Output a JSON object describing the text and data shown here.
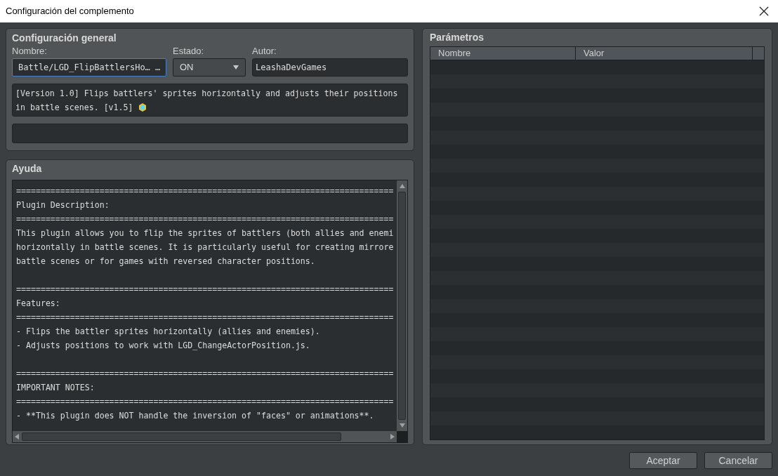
{
  "window": {
    "title": "Configuración del complemento"
  },
  "general": {
    "title": "Configuración general",
    "name": {
      "label": "Nombre:",
      "value": "Battle/LGD_FlipBattlersHo… …",
      "focused": true
    },
    "status": {
      "label": "Estado:",
      "value": "ON"
    },
    "author": {
      "label": "Autor:",
      "value": "LeashaDevGames"
    },
    "description": "[Version 1.0] Flips battlers' sprites horizontally and adjusts their positions in battle scenes. [v1.5]"
  },
  "help": {
    "title": "Ayuda",
    "lines": [
      {
        "kind": "text",
        "text": "============================================================================="
      },
      {
        "kind": "text",
        "text": "Plugin Description:"
      },
      {
        "kind": "text",
        "text": "============================================================================="
      },
      {
        "kind": "text",
        "text": "This plugin allows you to flip the sprites of battlers (both allies and enemi"
      },
      {
        "kind": "text",
        "text": "horizontally in battle scenes. It is particularly useful for creating mirrore"
      },
      {
        "kind": "text",
        "text": "battle scenes or for games with reversed character positions."
      },
      {
        "kind": "blank"
      },
      {
        "kind": "text",
        "text": "============================================================================="
      },
      {
        "kind": "text",
        "text": "Features:"
      },
      {
        "kind": "text",
        "text": "============================================================================="
      },
      {
        "kind": "text",
        "text": "- Flips the battler sprites horizontally (allies and enemies)."
      },
      {
        "kind": "text",
        "text": "- Adjusts positions to work with LGD_ChangeActorPosition.js."
      },
      {
        "kind": "blank"
      },
      {
        "kind": "text",
        "text": "============================================================================="
      },
      {
        "kind": "text",
        "text": "IMPORTANT NOTES:"
      },
      {
        "kind": "text",
        "text": "============================================================================="
      },
      {
        "kind": "text",
        "text": "- **This plugin does NOT handle the inversion of \"faces\" or animations**."
      }
    ]
  },
  "parameters": {
    "title": "Parámetros",
    "columns": [
      "Nombre",
      "Valor"
    ]
  },
  "buttons": [
    "Aceptar",
    "Cancelar"
  ]
}
